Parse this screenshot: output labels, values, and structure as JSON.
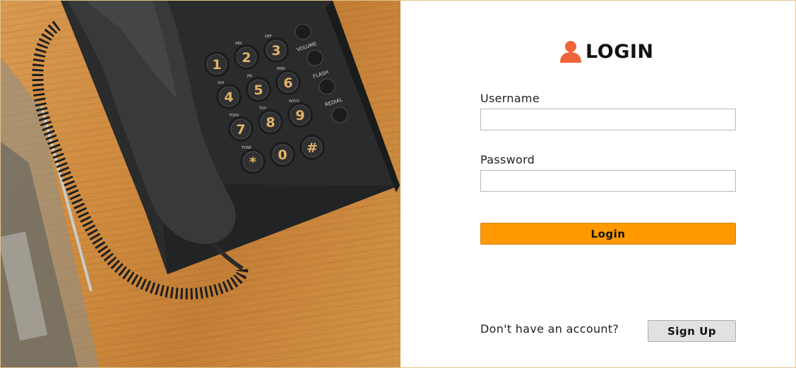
{
  "login": {
    "title": "LOGIN",
    "title_icon": "user-icon",
    "accent_color": "#ff9900",
    "icon_color": "#f0643a",
    "username_label": "Username",
    "username_value": "",
    "password_label": "Password",
    "password_value": "",
    "login_button": "Login",
    "signup_prompt": "Don't have an account?",
    "signup_button": "Sign Up"
  },
  "photo": {
    "keypad": [
      {
        "key": "1",
        "sub": ""
      },
      {
        "key": "2",
        "sub": "ABC"
      },
      {
        "key": "3",
        "sub": "DEF"
      },
      {
        "key": "4",
        "sub": "GHI"
      },
      {
        "key": "5",
        "sub": "JKL"
      },
      {
        "key": "6",
        "sub": "MNO"
      },
      {
        "key": "7",
        "sub": "PQRS"
      },
      {
        "key": "8",
        "sub": "TUV"
      },
      {
        "key": "9",
        "sub": "WXYZ"
      },
      {
        "key": "*",
        "sub": "TONE"
      },
      {
        "key": "0",
        "sub": ""
      },
      {
        "key": "#",
        "sub": ""
      }
    ],
    "side_labels": [
      "VOLUME",
      "FLASH",
      "REDIAL"
    ]
  }
}
